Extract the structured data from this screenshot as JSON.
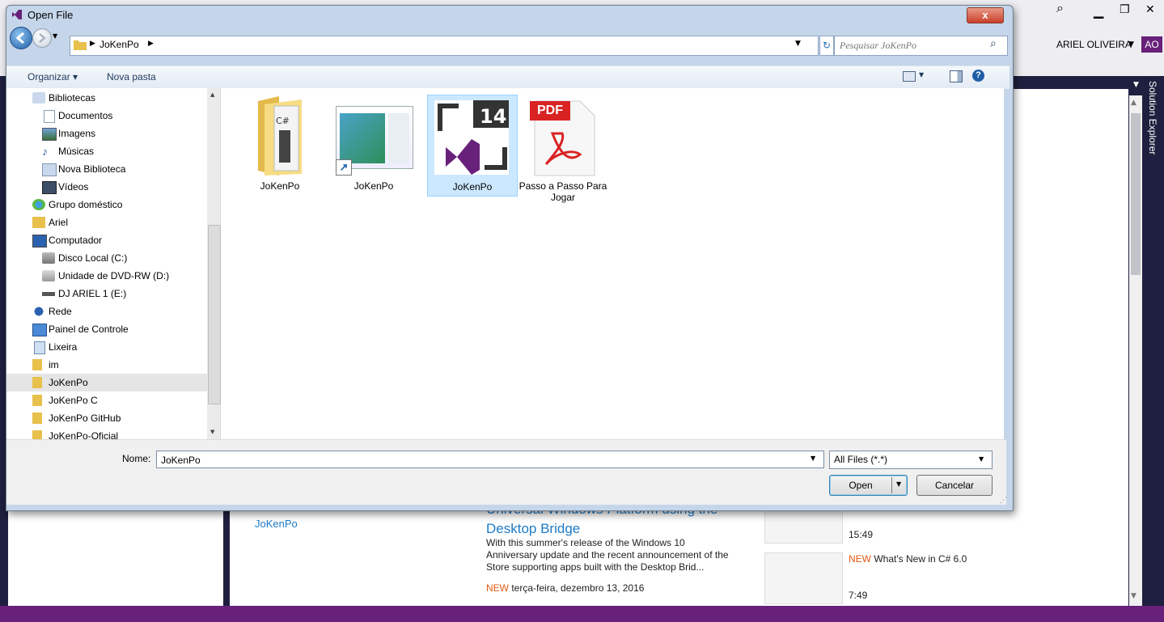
{
  "vs": {
    "user_name": "ARIEL OLIVEIRA",
    "user_initials": "AO",
    "solution_explorer_label": "Solution Explorer",
    "recent_item": "JoKenPo",
    "news": {
      "partial_title": "Universal Windows Platform using the",
      "title": "Desktop Bridge",
      "body": "With this summer's release of the Windows 10 Anniversary update and the recent announcement of the Store supporting apps built with the Desktop Brid...",
      "new_label": "NEW",
      "date": "terça-feira, dezembro 13, 2016"
    },
    "side_news": [
      {
        "time": "15:49"
      },
      {
        "new_label": "NEW",
        "title": "What's New in C# 6.0",
        "time": "7:49"
      }
    ],
    "window_controls": [
      "▁",
      "❐",
      "✕"
    ]
  },
  "dialog": {
    "title": "Open File",
    "close_label": "x",
    "address_segments": [
      "JoKenPo"
    ],
    "search_placeholder": "Pesquisar JoKenPo",
    "toolbar": {
      "organize_label": "Organizar ▾",
      "new_folder_label": "Nova pasta"
    },
    "nav_items": [
      {
        "label": "Bibliotecas",
        "icon": "libraries-icon",
        "indent": 1
      },
      {
        "label": "Documentos",
        "icon": "documents-icon",
        "indent": 2
      },
      {
        "label": "Imagens",
        "icon": "pictures-icon",
        "indent": 2
      },
      {
        "label": "Músicas",
        "icon": "music-icon",
        "indent": 2
      },
      {
        "label": "Nova Biblioteca",
        "icon": "library-icon",
        "indent": 2
      },
      {
        "label": "Vídeos",
        "icon": "videos-icon",
        "indent": 2
      },
      {
        "label": "Grupo doméstico",
        "icon": "homegroup-icon",
        "indent": 1
      },
      {
        "label": "Ariel",
        "icon": "user-folder-icon",
        "indent": 1
      },
      {
        "label": "Computador",
        "icon": "computer-icon",
        "indent": 1
      },
      {
        "label": "Disco Local (C:)",
        "icon": "drive-icon",
        "indent": 2
      },
      {
        "label": "Unidade de DVD-RW (D:)",
        "icon": "dvd-drive-icon",
        "indent": 2
      },
      {
        "label": "DJ ARIEL 1 (E:)",
        "icon": "removable-drive-icon",
        "indent": 2
      },
      {
        "label": "Rede",
        "icon": "network-icon",
        "indent": 1
      },
      {
        "label": "Painel de Controle",
        "icon": "control-panel-icon",
        "indent": 1
      },
      {
        "label": "Lixeira",
        "icon": "recycle-bin-icon",
        "indent": 1
      },
      {
        "label": "im",
        "icon": "folder-icon",
        "indent": 1
      },
      {
        "label": "JoKenPo",
        "icon": "folder-icon",
        "indent": 1,
        "selected": true
      },
      {
        "label": "JoKenPo C",
        "icon": "folder-icon",
        "indent": 1
      },
      {
        "label": "JoKenPo GitHub",
        "icon": "folder-icon",
        "indent": 1
      },
      {
        "label": "JoKenPo-Oficial",
        "icon": "folder-icon",
        "indent": 1
      }
    ],
    "files": [
      {
        "name": "JoKenPo",
        "icon": "csharp-folder-icon"
      },
      {
        "name": "JoKenPo",
        "icon": "shortcut-icon"
      },
      {
        "name": "JoKenPo",
        "icon": "visual-studio-solution-icon",
        "selected": true
      },
      {
        "name": "Passo a Passo Para Jogar",
        "icon": "pdf-icon",
        "badge": "PDF"
      }
    ],
    "file_name_label": "Nome:",
    "file_name_value": "JoKenPo",
    "filter_value": "All Files (*.*)",
    "open_label": "Open",
    "cancel_label": "Cancelar"
  }
}
